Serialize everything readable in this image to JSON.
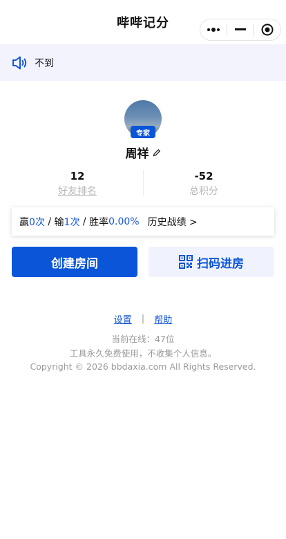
{
  "nav": {
    "title": "哔哔记分"
  },
  "notice": {
    "text": "不到"
  },
  "profile": {
    "badge": "专家",
    "name": "周祥"
  },
  "stats": [
    {
      "value": "12",
      "label": "好友排名"
    },
    {
      "value": "-52",
      "label": "总积分"
    }
  ],
  "record": {
    "win_prefix": "赢",
    "win_count": "0次",
    "sep1": " / ",
    "lose_prefix": "输",
    "lose_count": "1次",
    "sep2": " / ",
    "rate_prefix": "胜率",
    "rate_value": "0.00%",
    "history": "历史战绩 >"
  },
  "actions": {
    "create": "创建房间",
    "scan": "扫码进房"
  },
  "footer": {
    "settings": "设置",
    "divider": "|",
    "help": "帮助",
    "online": "当前在线：47位",
    "free_note": "工具永久免费使用，不收集个人信息。",
    "copyright": "Copyright © 2026 bbdaxia.com All Rights Reserved."
  },
  "colors": {
    "accent": "#0a55d8",
    "notice_bg": "#f2f3fd",
    "scan_bg": "#f0f2fd"
  },
  "icons": {
    "notice": "speaker-icon",
    "edit": "pencil-icon",
    "scan": "qr-code-icon",
    "more": "more-dots-icon",
    "minimize": "minimize-icon",
    "close": "target-close-icon"
  }
}
